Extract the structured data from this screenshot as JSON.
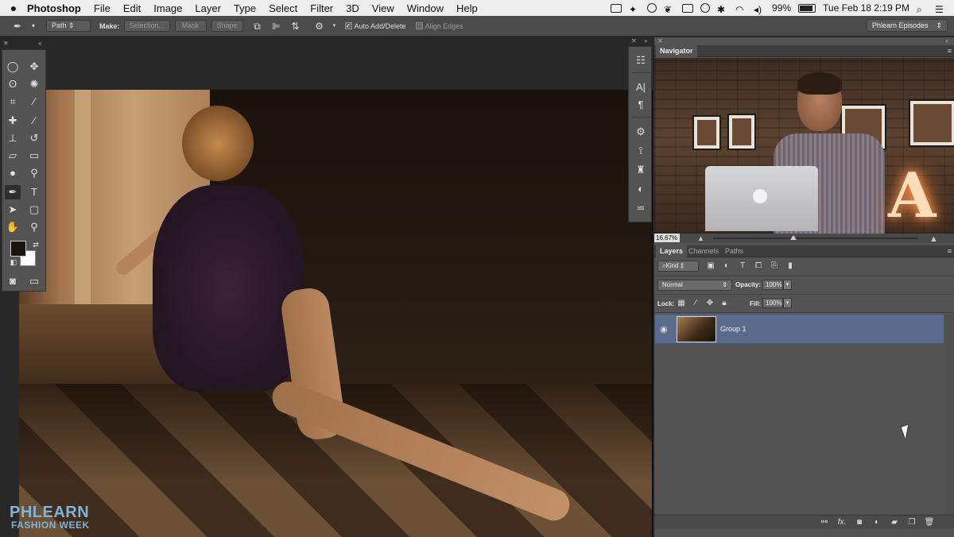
{
  "menubar": {
    "app": "Photoshop",
    "items": [
      "File",
      "Edit",
      "Image",
      "Layer",
      "Type",
      "Select",
      "Filter",
      "3D",
      "View",
      "Window",
      "Help"
    ],
    "battery": "99%",
    "clock": "Tue Feb 18  2:19 PM"
  },
  "options_bar": {
    "mode": "Path",
    "make_label": "Make:",
    "selection_btn": "Selection...",
    "mask_btn": "Mask",
    "shape_btn": "Shape",
    "auto_add_delete": "Auto Add/Delete",
    "auto_add_delete_checked": true,
    "align_edges": "Align Edges",
    "align_edges_checked": false,
    "workspace": "Phlearn Episodes"
  },
  "tools": {
    "active": "pen-tool",
    "foreground_color": "#1d140e",
    "background_color": "#ffffff"
  },
  "navigator": {
    "tab": "Navigator",
    "zoom": "16.67%",
    "zoom_fraction": 0.39
  },
  "layers_panel": {
    "tabs": [
      "Layers",
      "Channels",
      "Paths"
    ],
    "filter": "Kind",
    "blend_mode": "Normal",
    "opacity_label": "Opacity:",
    "opacity": "100%",
    "lock_label": "Lock:",
    "fill_label": "Fill:",
    "fill": "100%",
    "layers": [
      {
        "name": "Group 1",
        "visible": true,
        "selected": true
      }
    ]
  },
  "watermark": {
    "logo": "PHLEARN",
    "sub": "FASHION WEEK"
  },
  "colors": {
    "selection": "#5a6b8c",
    "panel": "#535353",
    "watermark": "#7fb4d8"
  }
}
